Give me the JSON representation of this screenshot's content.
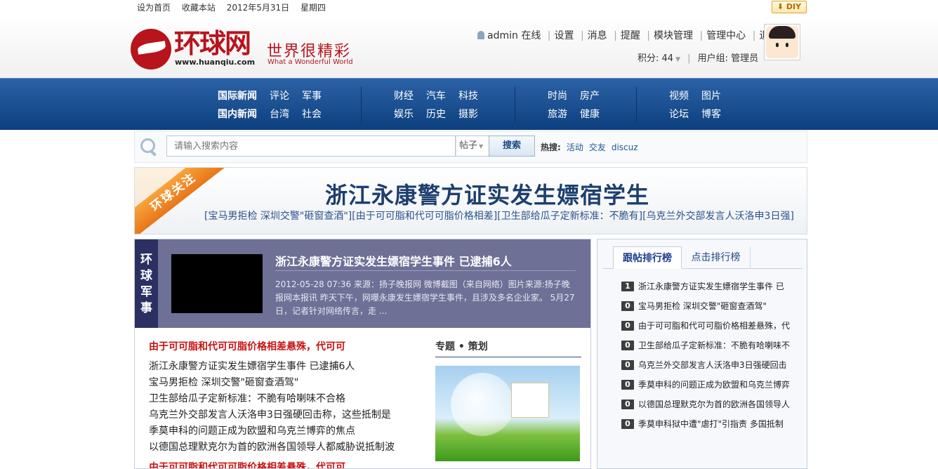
{
  "topbar": {
    "set_home": "设为首页",
    "bookmark": "收藏本站",
    "date": "2012年5月31日",
    "weekday": "星期四",
    "diy": "DIY"
  },
  "logo": {
    "name": "环球网",
    "url": "www.huanqiu.com",
    "slogan": "世界很精彩",
    "slogan_en": "What a Wonderful World"
  },
  "user": {
    "name": "admin",
    "status": "在线",
    "links": [
      "设置",
      "消息",
      "提醒",
      "模块管理",
      "管理中心",
      "退出"
    ],
    "points_label": "积分: 44",
    "group_label": "用户组: 管理员"
  },
  "nav": {
    "groups": [
      {
        "row1": [
          "国际新闻",
          "评论",
          "军事"
        ],
        "row2": [
          "国内新闻",
          "台湾",
          "社会"
        ]
      },
      {
        "row1": [
          "财经",
          "汽车",
          "科技"
        ],
        "row2": [
          "娱乐",
          "历史",
          "摄影"
        ]
      },
      {
        "row1": [
          "时尚",
          "房产"
        ],
        "row2": [
          "旅游",
          "健康"
        ]
      },
      {
        "row1": [
          "视频",
          "图片"
        ],
        "row2": [
          "论坛",
          "博客"
        ]
      }
    ]
  },
  "search": {
    "placeholder": "请输入搜索内容",
    "type": "帖子",
    "button": "搜索",
    "hot_label": "热搜:",
    "hot_terms": [
      "活动",
      "交友",
      "discuz"
    ]
  },
  "banner": {
    "ribbon": "环球关注",
    "title": "浙江永康警方证实发生嫖宿学生",
    "links": "[宝马男拒检 深圳交警\"砸窗查酒\"][由于可可脂和代可可脂价格相差][卫生部给瓜子定新标准：不脆有][乌克兰外交部发言人沃洛申3日强]"
  },
  "feature": {
    "side_tag": [
      "环",
      "球",
      "军",
      "事"
    ],
    "title": "浙江永康警方证实发生嫖宿学生事件 已逮捕6人",
    "desc": "2012-05-28 07:36 来源：扬子晚报网 微博截图（来自网络）图片来源:扬子晚报网本报讯 昨天下午，网曝永康发生嫖宿学生事件，且涉及多名企业家。 5月27日，记者针对网络传言，走 ..."
  },
  "news": {
    "headline": "由于可可脂和代可可脂价格相差悬殊，代可可",
    "items": [
      "浙江永康警方证实发生嫖宿学生事件 已逮捕6人",
      "宝马男拒检 深圳交警\"砸窗查酒驾\"",
      "卫生部给瓜子定新标准：不脆有哈喇味不合格",
      "乌克兰外交部发言人沃洛申3日强硬回击称，这些抵制是",
      "季莫申科的问题正成为欧盟和乌克兰博弈的焦点",
      "以德国总理默克尔为首的欧洲各国领导人都威胁说抵制波"
    ],
    "headline2": "由于可可脂和代可可脂价格相差悬殊，代可可"
  },
  "topic": {
    "title": "专题 • 策划"
  },
  "ranking": {
    "tab_active": "跟帖排行榜",
    "tab_other": "点击排行榜",
    "items": [
      {
        "num": "1",
        "text": "浙江永康警方证实发生嫖宿学生事件 已"
      },
      {
        "num": "0",
        "text": "宝马男拒检 深圳交警\"砸窗查酒驾\""
      },
      {
        "num": "0",
        "text": "由于可可脂和代可可脂价格相差悬殊，代"
      },
      {
        "num": "0",
        "text": "卫生部给瓜子定新标准：不脆有哈喇味不"
      },
      {
        "num": "0",
        "text": "乌克兰外交部发言人沃洛申3日强硬回击"
      },
      {
        "num": "0",
        "text": "季莫申科的问题正成为欧盟和乌克兰博弈"
      },
      {
        "num": "0",
        "text": "以德国总理默克尔为首的欧洲各国领导人"
      },
      {
        "num": "0",
        "text": "季莫申科狱中遭\"虐打\"引指责 多国抵制"
      }
    ]
  }
}
